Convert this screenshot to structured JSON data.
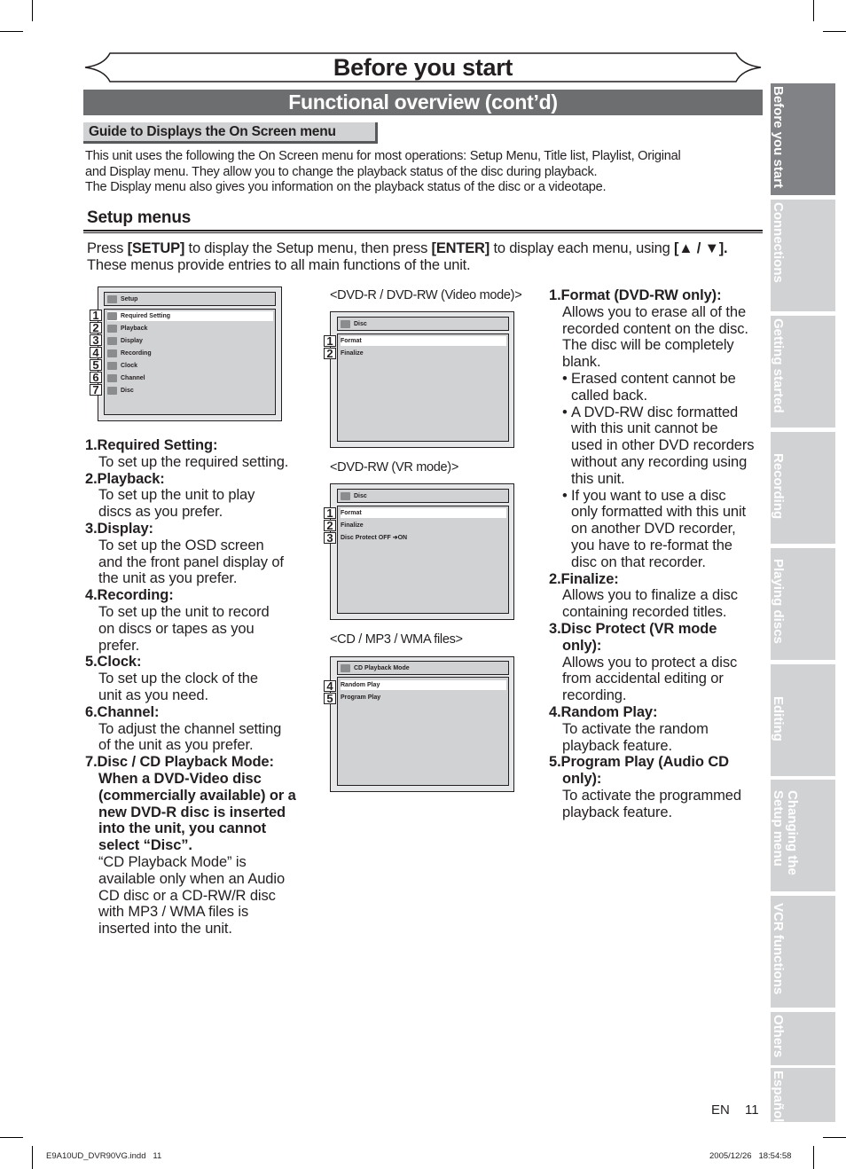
{
  "page": {
    "title": "Before you start",
    "section": "Functional overview (cont’d)",
    "guide_heading": "Guide to Displays the On Screen menu",
    "intro_lines": [
      "This unit uses the following the On Screen menu for most operations: Setup Menu, Title list, Playlist, Original",
      "and Display menu. They allow you to change the playback status of the disc during playback.",
      "The Display menu also gives you information on the playback status of the disc or a videotape."
    ],
    "setup_heading": "Setup menus",
    "press": {
      "pre": "Press ",
      "key1": "[SETUP]",
      "mid": " to display the Setup menu, then press ",
      "key2": "[ENTER]",
      "post": " to display each menu, using ",
      "key3": "[▲ / ▼].",
      "line2": "These menus provide entries to all main functions of the unit."
    }
  },
  "screens": {
    "setup": {
      "header": "Setup",
      "items": [
        {
          "num": "1",
          "label": "Required Setting",
          "icon": "wrench-icon",
          "selected": true
        },
        {
          "num": "2",
          "label": "Playback",
          "icon": "play-icon",
          "selected": false
        },
        {
          "num": "3",
          "label": "Display",
          "icon": "display-icon",
          "selected": false
        },
        {
          "num": "4",
          "label": "Recording",
          "icon": "recording-icon",
          "selected": false
        },
        {
          "num": "5",
          "label": "Clock",
          "icon": "clock-icon",
          "selected": false
        },
        {
          "num": "6",
          "label": "Channel",
          "icon": "channel-icon",
          "selected": false
        },
        {
          "num": "7",
          "label": "Disc",
          "icon": "disc-icon",
          "selected": false
        }
      ]
    },
    "video_mode": {
      "caption": "<DVD-R / DVD-RW (Video mode)>",
      "header": "Disc",
      "items": [
        {
          "num": "1",
          "label": "Format",
          "selected": true
        },
        {
          "num": "2",
          "label": "Finalize",
          "selected": false
        }
      ]
    },
    "vr_mode": {
      "caption": "<DVD-RW (VR mode)>",
      "header": "Disc",
      "items": [
        {
          "num": "1",
          "label": "Format",
          "selected": true
        },
        {
          "num": "2",
          "label": "Finalize",
          "selected": false
        },
        {
          "num": "3",
          "label": "Disc Protect OFF ➔ON",
          "selected": false
        }
      ]
    },
    "cd_mode": {
      "caption": "<CD / MP3 / WMA files>",
      "header": "CD Playback Mode",
      "items": [
        {
          "num": "4",
          "label": "Random Play",
          "selected": true
        },
        {
          "num": "5",
          "label": "Program Play",
          "selected": false
        }
      ]
    }
  },
  "left_desc": [
    {
      "title": "1.Required Setting:",
      "lines": [
        "To set up the required setting."
      ]
    },
    {
      "title": "2.Playback:",
      "lines": [
        "To set up the unit to play",
        "discs as you prefer."
      ]
    },
    {
      "title": "3.Display:",
      "lines": [
        "To set up the OSD screen",
        "and the front panel display of",
        "the unit as you prefer."
      ]
    },
    {
      "title": "4.Recording:",
      "lines": [
        "To set up the unit to record",
        "on discs or tapes as you",
        "prefer."
      ]
    },
    {
      "title": "5.Clock:",
      "lines": [
        "To set up the clock of the",
        "unit as you need."
      ]
    },
    {
      "title": "6.Channel:",
      "lines": [
        "To adjust the channel setting",
        "of the unit as you prefer."
      ]
    },
    {
      "title": "7.Disc / CD Playback Mode:",
      "bold_lines": [
        "When a DVD-Video disc",
        "(commercially available) or a",
        "new DVD-R disc is inserted",
        "into the unit, you cannot",
        "select “Disc”."
      ],
      "lines": [
        "“CD Playback Mode” is",
        "available only when an Audio",
        "CD disc or a CD-RW/R disc",
        "with MP3 / WMA files is",
        "inserted into the unit."
      ]
    }
  ],
  "right_desc": [
    {
      "title": "1.Format (DVD-RW only):",
      "lines": [
        "Allows you to erase all of the",
        "recorded content on the disc.",
        "The disc will be completely",
        "blank."
      ],
      "bullets": [
        [
          "Erased content cannot be",
          "called back."
        ],
        [
          "A DVD-RW disc formatted",
          "with this unit cannot be",
          "used in other DVD recorders",
          "without any recording using",
          "this unit."
        ],
        [
          "If you want to use a disc",
          "only formatted with this unit",
          "on another DVD recorder,",
          "you have to re-format the",
          "disc on that recorder."
        ]
      ]
    },
    {
      "title": "2.Finalize:",
      "lines": [
        "Allows you to finalize a disc",
        "containing recorded titles."
      ]
    },
    {
      "title": "3.Disc Protect (VR mode",
      "title2": "only):",
      "lines": [
        "Allows you to protect a disc",
        "from accidental editing or",
        "recording."
      ]
    },
    {
      "title": "4.Random Play:",
      "lines": [
        "To activate the random",
        "playback feature."
      ]
    },
    {
      "title": "5.Program Play (Audio CD",
      "title2": "only):",
      "lines": [
        "To activate the programmed",
        "playback feature."
      ]
    }
  ],
  "side_tabs": [
    {
      "label": "Before you start",
      "active": true
    },
    {
      "label": "Connections",
      "active": false
    },
    {
      "label": "Getting started",
      "active": false
    },
    {
      "label": "Recording",
      "active": false
    },
    {
      "label": "Playing discs",
      "active": false
    },
    {
      "label": "Editing",
      "active": false
    },
    {
      "label": "Changing the\nSetup menu",
      "active": false
    },
    {
      "label": "VCR functions",
      "active": false
    },
    {
      "label": "Others",
      "active": false
    },
    {
      "label": "Español",
      "active": false
    }
  ],
  "page_number": {
    "lang": "EN",
    "num": "11"
  },
  "footer": {
    "file": "E9A10UD_DVR90VG.indd   11",
    "timestamp": "2005/12/26   18:54:58"
  },
  "colors": {
    "section_bar": "#6d6e70",
    "tab_active": "#808285",
    "tab_inactive": "#d1d2d4"
  }
}
